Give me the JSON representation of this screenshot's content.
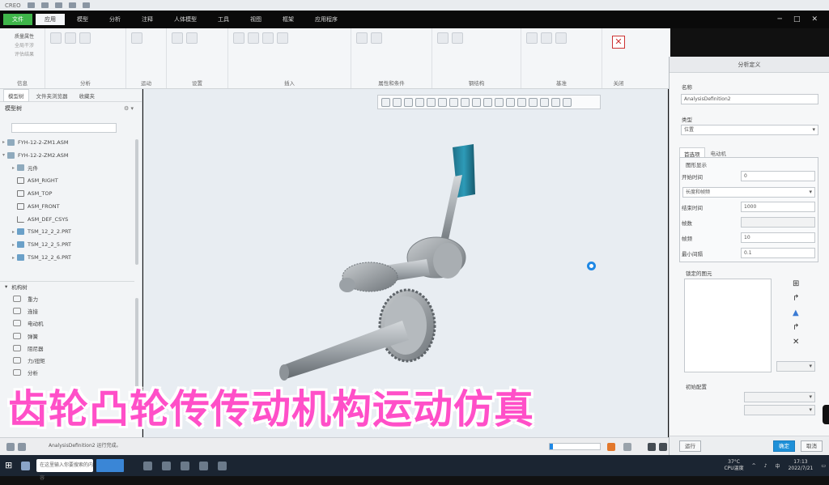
{
  "titlebar": {
    "app_name": "CREO"
  },
  "ribbon": {
    "tabs": [
      {
        "label": "文件",
        "active": false,
        "is_file": true
      },
      {
        "label": "应用",
        "active": true
      },
      {
        "label": "模型"
      },
      {
        "label": "分析"
      },
      {
        "label": "注释"
      },
      {
        "label": "人体模型"
      },
      {
        "label": "工具"
      },
      {
        "label": "视图"
      },
      {
        "label": "框架"
      },
      {
        "label": "应用程序"
      }
    ],
    "groups": [
      {
        "label": "信息",
        "items": [
          "质量属性",
          "全局干涉",
          "评估结果"
        ]
      },
      {
        "label": "分析"
      },
      {
        "label": "运动"
      },
      {
        "label": "设置"
      },
      {
        "label": "插入"
      },
      {
        "label": "属性和条件"
      },
      {
        "label": "钢结构"
      },
      {
        "label": "基准"
      },
      {
        "label": "关闭"
      }
    ]
  },
  "left_panel": {
    "tabs": [
      "模型树",
      "文件夹浏览器",
      "收藏夹"
    ],
    "tree_header": "模型树",
    "tree_items": [
      {
        "label": "FYH-12-2-ZM1.ASM",
        "icon": "assembly-icon",
        "expand": "▸"
      },
      {
        "label": "FYH-12-2-ZM2.ASM",
        "icon": "assembly-icon",
        "expand": "▾"
      },
      {
        "label": "元件",
        "icon": "folder-icon",
        "expand": "▸"
      },
      {
        "label": "ASM_RIGHT",
        "icon": "plane-icon",
        "expand": ""
      },
      {
        "label": "ASM_TOP",
        "icon": "plane-icon",
        "expand": ""
      },
      {
        "label": "ASM_FRONT",
        "icon": "plane-icon",
        "expand": ""
      },
      {
        "label": "ASM_DEF_CSYS",
        "icon": "csys-icon",
        "expand": ""
      },
      {
        "label": "TSM_12_2_2.PRT",
        "icon": "part-icon",
        "expand": "▸"
      },
      {
        "label": "TSM_12_2_5.PRT",
        "icon": "part-icon",
        "expand": "▸"
      },
      {
        "label": "TSM_12_2_6.PRT",
        "icon": "part-icon",
        "expand": "▸"
      }
    ],
    "mech_section_title": "机构树",
    "mech_items": [
      "重力",
      "连接",
      "电动机",
      "弹簧",
      "阻尼器",
      "力/扭矩",
      "分析"
    ]
  },
  "viewport": {
    "spinner_color": "#1e88e5"
  },
  "dialog": {
    "title": "分析定义",
    "name_label": "名称",
    "name_value": "AnalysisDefinition2",
    "type_label": "类型",
    "type_value": "位置",
    "tabs": [
      "首选项",
      "电动机"
    ],
    "graph_section": "图形显示",
    "start_time_label": "开始时间",
    "start_time_value": "0",
    "mode_value": "长度和帧频",
    "end_time_label": "结束时间",
    "end_time_value": "1000",
    "frames_label": "帧数",
    "frames_value": "",
    "rate_label": "帧频",
    "rate_value": "10",
    "min_interval_label": "最小间隔",
    "min_interval_value": "0.1",
    "lock_section": "锁定的图元",
    "init_config_label": "初始配置",
    "run_button": "运行",
    "ok_button": "确定",
    "cancel_button": "取消"
  },
  "statusbar": {
    "message": "AnalysisDefinition2 运行完成。"
  },
  "taskbar": {
    "search_text": "在这里输入你要搜索的内容",
    "temperature": "37°C",
    "temp_desc": "CPU温度",
    "time": "17:13",
    "date": "2022/7/21"
  },
  "overlay": {
    "caption": "齿轮凸轮传传动机构运动仿真",
    "caption_color": "#ff4fc8"
  }
}
